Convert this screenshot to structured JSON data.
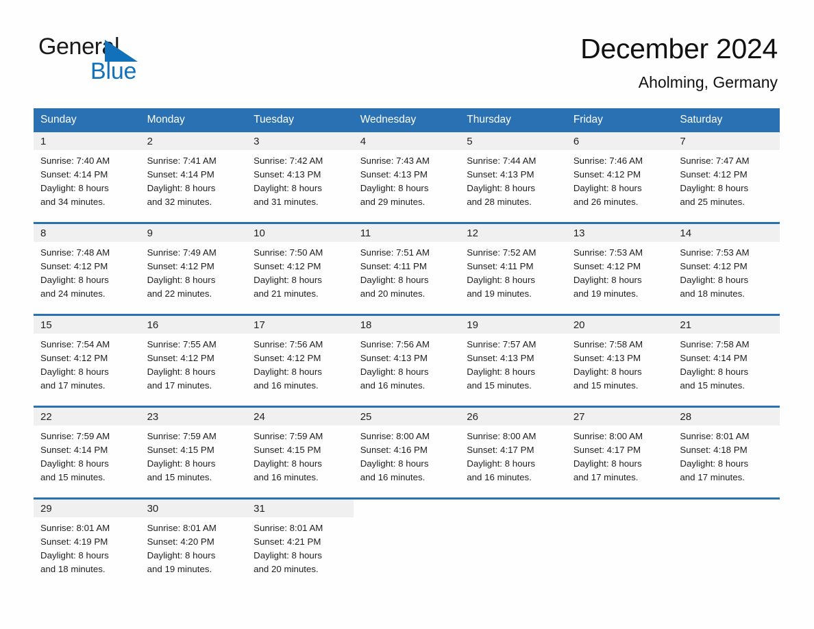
{
  "brand": {
    "name_part1": "General",
    "name_part2": "Blue",
    "logo_icon": "triangle-flag-icon",
    "accent_color": "#1271bb"
  },
  "header": {
    "title": "December 2024",
    "location": "Aholming, Germany"
  },
  "theme": {
    "header_blue": "#2a71b3",
    "daynum_band": "#f0f0f0",
    "page_background": "#fefefe"
  },
  "weekday_headers": [
    "Sunday",
    "Monday",
    "Tuesday",
    "Wednesday",
    "Thursday",
    "Friday",
    "Saturday"
  ],
  "weeks": [
    [
      {
        "day": "1",
        "sunrise": "Sunrise: 7:40 AM",
        "sunset": "Sunset: 4:14 PM",
        "daylight1": "Daylight: 8 hours",
        "daylight2": "and 34 minutes."
      },
      {
        "day": "2",
        "sunrise": "Sunrise: 7:41 AM",
        "sunset": "Sunset: 4:14 PM",
        "daylight1": "Daylight: 8 hours",
        "daylight2": "and 32 minutes."
      },
      {
        "day": "3",
        "sunrise": "Sunrise: 7:42 AM",
        "sunset": "Sunset: 4:13 PM",
        "daylight1": "Daylight: 8 hours",
        "daylight2": "and 31 minutes."
      },
      {
        "day": "4",
        "sunrise": "Sunrise: 7:43 AM",
        "sunset": "Sunset: 4:13 PM",
        "daylight1": "Daylight: 8 hours",
        "daylight2": "and 29 minutes."
      },
      {
        "day": "5",
        "sunrise": "Sunrise: 7:44 AM",
        "sunset": "Sunset: 4:13 PM",
        "daylight1": "Daylight: 8 hours",
        "daylight2": "and 28 minutes."
      },
      {
        "day": "6",
        "sunrise": "Sunrise: 7:46 AM",
        "sunset": "Sunset: 4:12 PM",
        "daylight1": "Daylight: 8 hours",
        "daylight2": "and 26 minutes."
      },
      {
        "day": "7",
        "sunrise": "Sunrise: 7:47 AM",
        "sunset": "Sunset: 4:12 PM",
        "daylight1": "Daylight: 8 hours",
        "daylight2": "and 25 minutes."
      }
    ],
    [
      {
        "day": "8",
        "sunrise": "Sunrise: 7:48 AM",
        "sunset": "Sunset: 4:12 PM",
        "daylight1": "Daylight: 8 hours",
        "daylight2": "and 24 minutes."
      },
      {
        "day": "9",
        "sunrise": "Sunrise: 7:49 AM",
        "sunset": "Sunset: 4:12 PM",
        "daylight1": "Daylight: 8 hours",
        "daylight2": "and 22 minutes."
      },
      {
        "day": "10",
        "sunrise": "Sunrise: 7:50 AM",
        "sunset": "Sunset: 4:12 PM",
        "daylight1": "Daylight: 8 hours",
        "daylight2": "and 21 minutes."
      },
      {
        "day": "11",
        "sunrise": "Sunrise: 7:51 AM",
        "sunset": "Sunset: 4:11 PM",
        "daylight1": "Daylight: 8 hours",
        "daylight2": "and 20 minutes."
      },
      {
        "day": "12",
        "sunrise": "Sunrise: 7:52 AM",
        "sunset": "Sunset: 4:11 PM",
        "daylight1": "Daylight: 8 hours",
        "daylight2": "and 19 minutes."
      },
      {
        "day": "13",
        "sunrise": "Sunrise: 7:53 AM",
        "sunset": "Sunset: 4:12 PM",
        "daylight1": "Daylight: 8 hours",
        "daylight2": "and 19 minutes."
      },
      {
        "day": "14",
        "sunrise": "Sunrise: 7:53 AM",
        "sunset": "Sunset: 4:12 PM",
        "daylight1": "Daylight: 8 hours",
        "daylight2": "and 18 minutes."
      }
    ],
    [
      {
        "day": "15",
        "sunrise": "Sunrise: 7:54 AM",
        "sunset": "Sunset: 4:12 PM",
        "daylight1": "Daylight: 8 hours",
        "daylight2": "and 17 minutes."
      },
      {
        "day": "16",
        "sunrise": "Sunrise: 7:55 AM",
        "sunset": "Sunset: 4:12 PM",
        "daylight1": "Daylight: 8 hours",
        "daylight2": "and 17 minutes."
      },
      {
        "day": "17",
        "sunrise": "Sunrise: 7:56 AM",
        "sunset": "Sunset: 4:12 PM",
        "daylight1": "Daylight: 8 hours",
        "daylight2": "and 16 minutes."
      },
      {
        "day": "18",
        "sunrise": "Sunrise: 7:56 AM",
        "sunset": "Sunset: 4:13 PM",
        "daylight1": "Daylight: 8 hours",
        "daylight2": "and 16 minutes."
      },
      {
        "day": "19",
        "sunrise": "Sunrise: 7:57 AM",
        "sunset": "Sunset: 4:13 PM",
        "daylight1": "Daylight: 8 hours",
        "daylight2": "and 15 minutes."
      },
      {
        "day": "20",
        "sunrise": "Sunrise: 7:58 AM",
        "sunset": "Sunset: 4:13 PM",
        "daylight1": "Daylight: 8 hours",
        "daylight2": "and 15 minutes."
      },
      {
        "day": "21",
        "sunrise": "Sunrise: 7:58 AM",
        "sunset": "Sunset: 4:14 PM",
        "daylight1": "Daylight: 8 hours",
        "daylight2": "and 15 minutes."
      }
    ],
    [
      {
        "day": "22",
        "sunrise": "Sunrise: 7:59 AM",
        "sunset": "Sunset: 4:14 PM",
        "daylight1": "Daylight: 8 hours",
        "daylight2": "and 15 minutes."
      },
      {
        "day": "23",
        "sunrise": "Sunrise: 7:59 AM",
        "sunset": "Sunset: 4:15 PM",
        "daylight1": "Daylight: 8 hours",
        "daylight2": "and 15 minutes."
      },
      {
        "day": "24",
        "sunrise": "Sunrise: 7:59 AM",
        "sunset": "Sunset: 4:15 PM",
        "daylight1": "Daylight: 8 hours",
        "daylight2": "and 16 minutes."
      },
      {
        "day": "25",
        "sunrise": "Sunrise: 8:00 AM",
        "sunset": "Sunset: 4:16 PM",
        "daylight1": "Daylight: 8 hours",
        "daylight2": "and 16 minutes."
      },
      {
        "day": "26",
        "sunrise": "Sunrise: 8:00 AM",
        "sunset": "Sunset: 4:17 PM",
        "daylight1": "Daylight: 8 hours",
        "daylight2": "and 16 minutes."
      },
      {
        "day": "27",
        "sunrise": "Sunrise: 8:00 AM",
        "sunset": "Sunset: 4:17 PM",
        "daylight1": "Daylight: 8 hours",
        "daylight2": "and 17 minutes."
      },
      {
        "day": "28",
        "sunrise": "Sunrise: 8:01 AM",
        "sunset": "Sunset: 4:18 PM",
        "daylight1": "Daylight: 8 hours",
        "daylight2": "and 17 minutes."
      }
    ],
    [
      {
        "day": "29",
        "sunrise": "Sunrise: 8:01 AM",
        "sunset": "Sunset: 4:19 PM",
        "daylight1": "Daylight: 8 hours",
        "daylight2": "and 18 minutes."
      },
      {
        "day": "30",
        "sunrise": "Sunrise: 8:01 AM",
        "sunset": "Sunset: 4:20 PM",
        "daylight1": "Daylight: 8 hours",
        "daylight2": "and 19 minutes."
      },
      {
        "day": "31",
        "sunrise": "Sunrise: 8:01 AM",
        "sunset": "Sunset: 4:21 PM",
        "daylight1": "Daylight: 8 hours",
        "daylight2": "and 20 minutes."
      },
      {
        "day": "",
        "sunrise": "",
        "sunset": "",
        "daylight1": "",
        "daylight2": ""
      },
      {
        "day": "",
        "sunrise": "",
        "sunset": "",
        "daylight1": "",
        "daylight2": ""
      },
      {
        "day": "",
        "sunrise": "",
        "sunset": "",
        "daylight1": "",
        "daylight2": ""
      },
      {
        "day": "",
        "sunrise": "",
        "sunset": "",
        "daylight1": "",
        "daylight2": ""
      }
    ]
  ]
}
